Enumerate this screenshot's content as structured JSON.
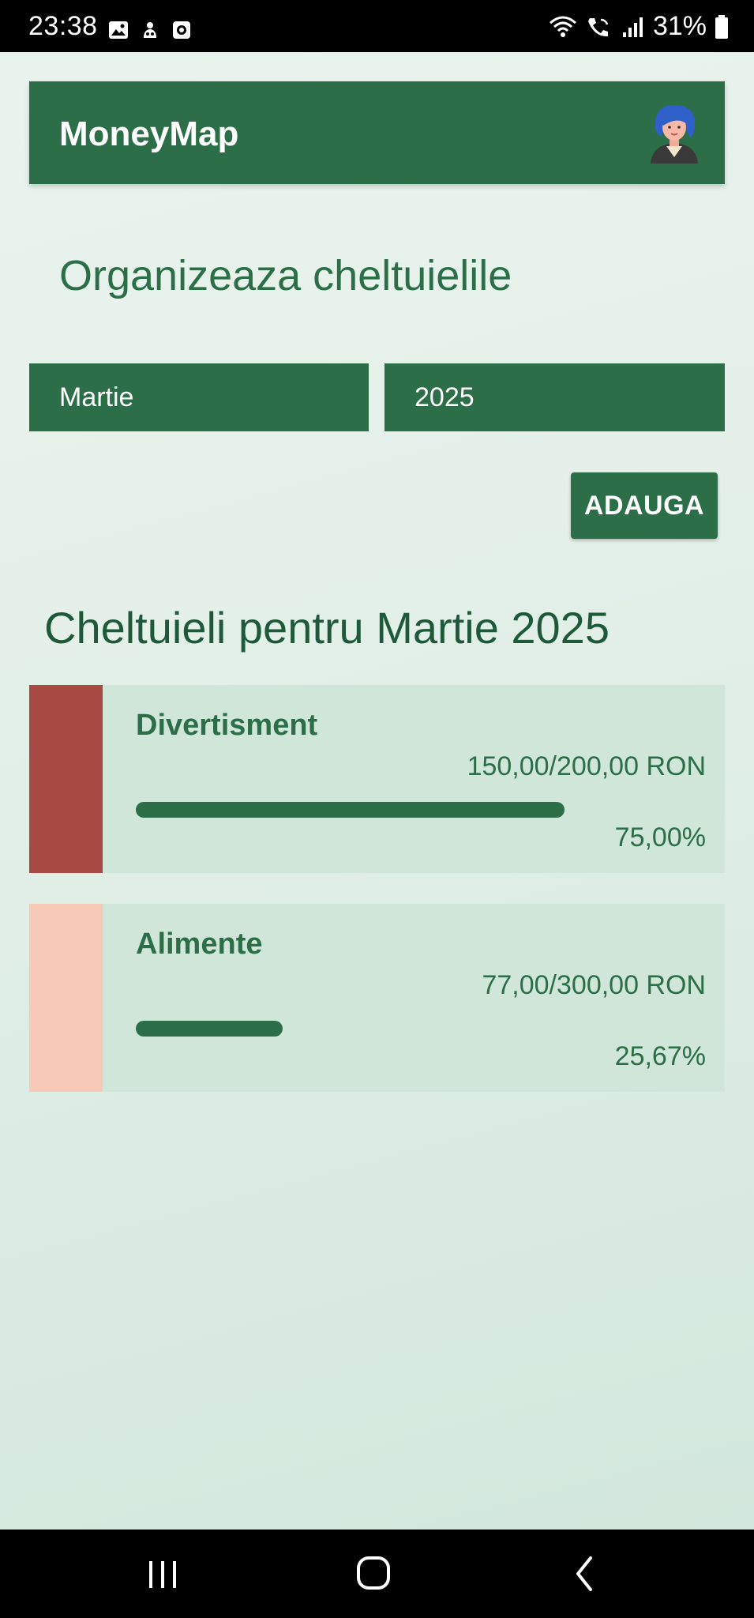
{
  "status_bar": {
    "time": "23:38",
    "battery": "31%",
    "left_icons": [
      "gallery-icon",
      "notification-icon",
      "app-icon"
    ],
    "right_icons": [
      "wifi-icon",
      "wifi-call-icon",
      "signal-icon",
      "battery-icon"
    ]
  },
  "toolbar": {
    "title": "MoneyMap",
    "avatar_icon": "avatar-woman-icon"
  },
  "page": {
    "title": "Organizeaza cheltuielile"
  },
  "filters": {
    "month": "Martie",
    "year": "2025"
  },
  "add_button": {
    "label": "ADAUGA"
  },
  "section": {
    "title": "Cheltuieli pentru Martie 2025"
  },
  "expenses": [
    {
      "name": "Divertisment",
      "amount": "150,00/200,00 RON",
      "percent": "75,00%",
      "progress": 0.75,
      "color": "#a84a43"
    },
    {
      "name": "Alimente",
      "amount": "77,00/300,00 RON",
      "percent": "25,67%",
      "progress": 0.2567,
      "color": "#f7c9b7"
    }
  ],
  "colors": {
    "primary": "#2c6e48",
    "card_background": "#cfe6d8",
    "section_title": "#1e5a3a"
  },
  "nav_bar": {
    "buttons": [
      "recents-icon",
      "home-icon",
      "back-icon"
    ]
  }
}
